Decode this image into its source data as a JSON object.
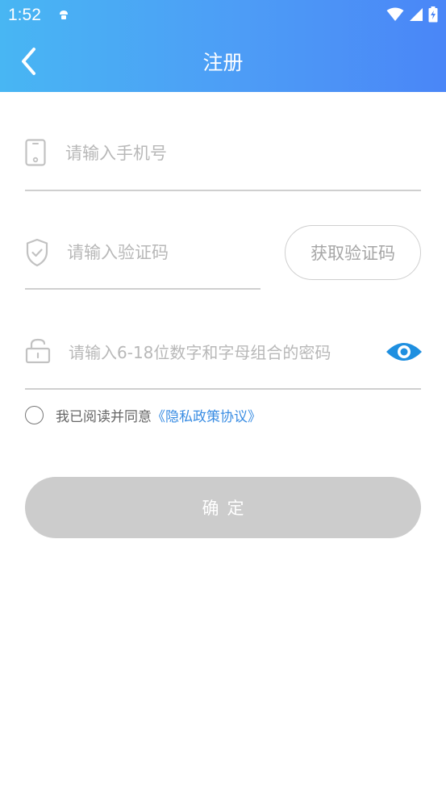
{
  "status_bar": {
    "time": "1:52",
    "notification_icon": "android-bug-icon",
    "icons": [
      "wifi-icon",
      "cell-signal-icon",
      "battery-charging-icon"
    ]
  },
  "header": {
    "title": "注册",
    "back_icon": "chevron-left-icon",
    "gradient": [
      "#48b6f3",
      "#4a86f7"
    ]
  },
  "form": {
    "phone": {
      "placeholder": "请输入手机号",
      "value": "",
      "icon": "phone-icon"
    },
    "code": {
      "placeholder": "请输入验证码",
      "value": "",
      "icon": "shield-check-icon",
      "button_label": "获取验证码"
    },
    "password": {
      "placeholder": "请输入6-18位数字和字母组合的密码",
      "value": "",
      "icon": "unlock-icon",
      "toggle_icon": "eye-icon"
    }
  },
  "agreement": {
    "text": "我已阅读并同意",
    "link": "《隐私政策协议》",
    "checked": false
  },
  "confirm": {
    "label": "确定"
  },
  "colors": {
    "link": "#3a8de3",
    "eye": "#1e8fe0",
    "disabled_button": "#cccccc",
    "divider": "#cfcfcf"
  }
}
